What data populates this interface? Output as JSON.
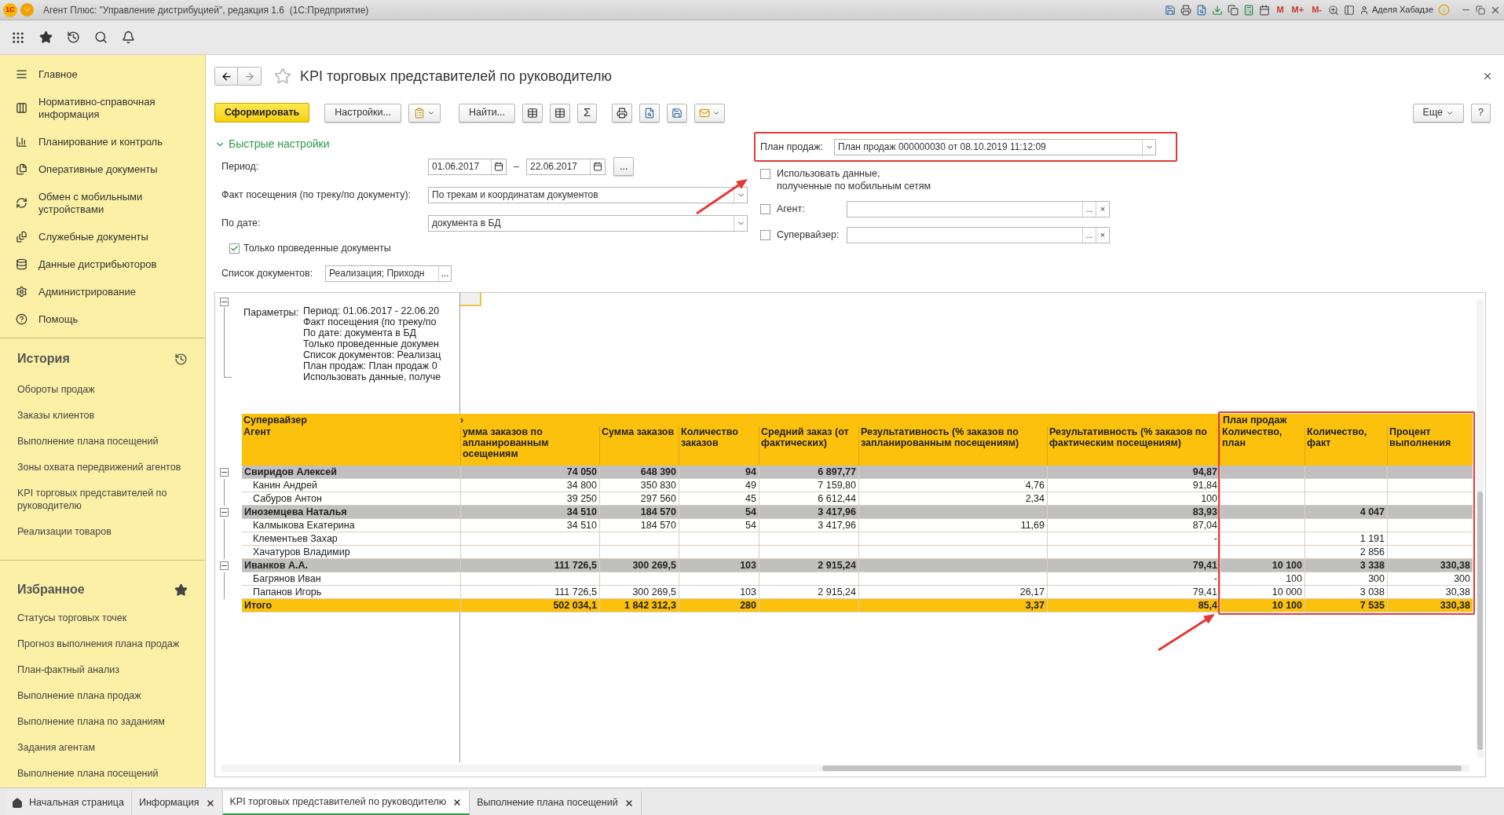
{
  "title_bar": {
    "logo": "1С",
    "title": "Агент Плюс: \"Управление дистрибуцией\", редакция 1.6  (1С:Предприятие)",
    "memory_buttons": [
      "M",
      "M+",
      "M-"
    ],
    "user": "Аделя Хабадзе"
  },
  "sidebar": {
    "sections": [
      {
        "label": "Главное"
      },
      {
        "label": "Нормативно-справочная информация"
      },
      {
        "label": "Планирование и контроль"
      },
      {
        "label": "Оперативные документы"
      },
      {
        "label": "Обмен с мобильными устройствами"
      },
      {
        "label": "Служебные документы"
      },
      {
        "label": "Данные дистрибьюторов"
      },
      {
        "label": "Администрирование"
      },
      {
        "label": "Помощь"
      }
    ],
    "history": {
      "title": "История",
      "items": [
        "Обороты продаж",
        "Заказы клиентов",
        "Выполнение плана посещений",
        "Зоны охвата передвижений агентов",
        "KPI торговых представителей по руководителю",
        "Реализации товаров"
      ]
    },
    "favorites": {
      "title": "Избранное",
      "items": [
        "Статусы торговых точек",
        "Прогноз выполнения плана продаж",
        "План-фактный анализ",
        "Выполнение плана продаж",
        "Выполнение плана по заданиям",
        "Задания агентам",
        "Выполнение плана посещений"
      ]
    }
  },
  "form": {
    "title": "KPI торговых представителей по руководителю",
    "toolbar": {
      "generate": "Сформировать",
      "settings": "Настройки...",
      "find": "Найти...",
      "sum": "Σ",
      "more": "Еще",
      "help": "?"
    },
    "quick_settings": {
      "title": "Быстрые настройки",
      "expanded": true
    },
    "period": {
      "label": "Период:",
      "from": "01.06.2017",
      "dash": "–",
      "to": "22.06.2017",
      "button": "..."
    },
    "visit_fact": {
      "label": "Факт посещения (по треку/по документу):",
      "value": "По трекам и координатам документов"
    },
    "by_date": {
      "label": "По дате:",
      "value": "документа в БД"
    },
    "only_posted": {
      "label": "Только проведенные документы",
      "checked": true
    },
    "doc_list": {
      "label": "Список документов:",
      "value": "Реализация; Приходн",
      "button": "..."
    },
    "sales_plan": {
      "label": "План продаж:",
      "value": "План продаж 000000030 от 08.10.2019 11:12:09"
    },
    "use_mobile": {
      "label": "Использовать данные,\nполученные по мобильным сетям",
      "checked": false
    },
    "agent": {
      "label": "Агент:",
      "checked": false,
      "button": "...",
      "clear": "×"
    },
    "supervisor": {
      "label": "Супервайзер:",
      "checked": false,
      "button": "...",
      "clear": "×"
    }
  },
  "report": {
    "parameters": {
      "label": "Параметры:",
      "expanded": true,
      "lines": [
        "Период: 01.06.2017 - 22.06.20",
        "Факт посещения (по треку/по",
        "По дате: документа в БД",
        "Только проведенные докумен",
        "Список документов: Реализац",
        "План продаж: План продаж 0",
        "Использовать данные, получе"
      ]
    },
    "group_header": "Супервайзер",
    "group_header_mark": "›",
    "plan_header": "План продаж",
    "columns": [
      "Агент",
      "умма заказов по апланированным осещениям",
      "Сумма заказов",
      "Количество заказов",
      "Средний заказ (от фактических)",
      "Результативность (% заказов по запланированным посещениям)",
      "Результативность (% заказов по фактическим посещениям)",
      "Количество, план",
      "Количество, факт",
      "Процент выполнения"
    ],
    "rows": [
      {
        "kind": "group",
        "expanded": true,
        "cells": [
          "Свиридов Алексей",
          "74 050",
          "648 390",
          "94",
          "6 897,77",
          null,
          "94,87",
          null,
          null,
          null
        ]
      },
      {
        "kind": "agent",
        "cells": [
          "Канин Андрей",
          "34 800",
          "350 830",
          "49",
          "7 159,80",
          "4,76",
          "91,84",
          null,
          null,
          null
        ]
      },
      {
        "kind": "agent",
        "cells": [
          "Сабуров Антон",
          "39 250",
          "297 560",
          "45",
          "6 612,44",
          "2,34",
          "100",
          null,
          null,
          null
        ]
      },
      {
        "kind": "group",
        "expanded": true,
        "cells": [
          "Иноземцева Наталья",
          "34 510",
          "184 570",
          "54",
          "3 417,96",
          null,
          "83,93",
          null,
          "4 047",
          null
        ]
      },
      {
        "kind": "agent",
        "cells": [
          "Калмыкова Екатерина",
          "34 510",
          "184 570",
          "54",
          "3 417,96",
          "11,69",
          "87,04",
          null,
          null,
          null
        ]
      },
      {
        "kind": "agent",
        "cells": [
          "Клементьев Захар",
          null,
          null,
          null,
          null,
          null,
          "-",
          null,
          "1 191",
          null
        ]
      },
      {
        "kind": "agent",
        "cells": [
          "Хачатуров Владимир",
          null,
          null,
          null,
          null,
          null,
          null,
          null,
          "2 856",
          null
        ]
      },
      {
        "kind": "group",
        "expanded": true,
        "cells": [
          "Иванков А.А.",
          "111 726,5",
          "300 269,5",
          "103",
          "2 915,24",
          null,
          "79,41",
          "10 100",
          "3 338",
          "330,38"
        ]
      },
      {
        "kind": "agent",
        "cells": [
          "Багрянов Иван",
          null,
          null,
          null,
          null,
          null,
          "-",
          "100",
          "300",
          "300"
        ]
      },
      {
        "kind": "agent",
        "cells": [
          "Папанов Игорь",
          "111 726,5",
          "300 269,5",
          "103",
          "2 915,24",
          "26,17",
          "79,41",
          "10 000",
          "3 038",
          "30,38"
        ]
      },
      {
        "kind": "total",
        "cells": [
          "Итого",
          "502 034,1",
          "1 842 312,3",
          "280",
          null,
          "3,37",
          "85,4",
          "10 100",
          "7 535",
          "330,38"
        ]
      }
    ]
  },
  "tabs": [
    {
      "label": "Начальная страница",
      "kind": "home",
      "selected": false
    },
    {
      "label": "Информация",
      "kind": "closable",
      "selected": false
    },
    {
      "label": "KPI торговых представителей по руководителю",
      "kind": "closable",
      "selected": true
    },
    {
      "label": "Выполнение плана посещений",
      "kind": "closable",
      "selected": false
    }
  ]
}
